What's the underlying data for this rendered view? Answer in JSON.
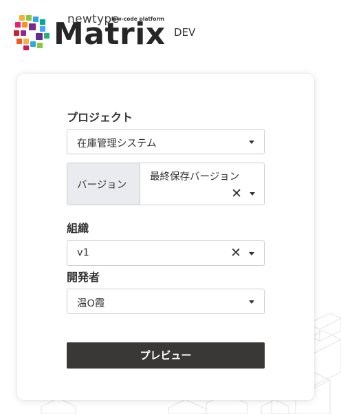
{
  "logo": {
    "brand_small": "newtype",
    "tagline": "low-code platform",
    "brand": "Matrix",
    "environment": "DEV"
  },
  "form": {
    "project": {
      "label": "プロジェクト",
      "value": "在庫管理システム"
    },
    "version": {
      "addon_label": "バージョン",
      "value": "最終保存バージョン"
    },
    "organization": {
      "label": "組織",
      "value": "v1"
    },
    "developer": {
      "label": "開発者",
      "value": "温O霞"
    },
    "preview_button": "プレビュー"
  },
  "icons": {
    "clear": "close-icon",
    "dropdown": "chevron-down-icon",
    "logo": "matrix-logo-icon"
  },
  "colors": {
    "button_bg": "#3a3737",
    "addon_bg": "#e9ebee",
    "text": "#333333"
  }
}
